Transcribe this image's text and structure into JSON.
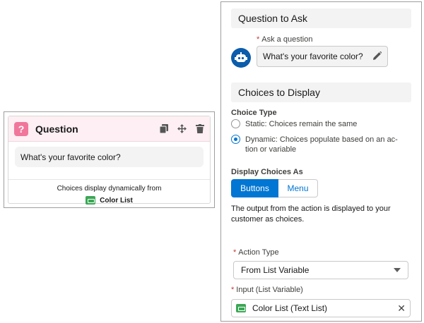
{
  "question_card": {
    "badge": "?",
    "title": "Question",
    "question_text": "What's your favorite color?",
    "footer_line1": "Choices display dynamically from",
    "footer_source": "Color List"
  },
  "panel": {
    "section1_title": "Question to Ask",
    "ask_label": "Ask a question",
    "ask_value": "What's your favorite color?",
    "section2_title": "Choices to Display",
    "choice_type_label": "Choice Type",
    "choice_static": "Static: Choices remain the same",
    "choice_dynamic": "Dynamic: Choices populate based on an ac-tion or variable",
    "display_as_label": "Display Choices As",
    "btn_buttons": "Buttons",
    "btn_menu": "Menu",
    "description": "The output from the action is displayed to your customer as choices.",
    "action_type_label": "Action Type",
    "action_type_value": "From List Variable",
    "input_label": "Input (List Variable)",
    "input_value": "Color List (Text List)",
    "required_mark": "*"
  },
  "colors": {
    "accent": "#0176d3",
    "question_badge": "#f1769c",
    "list_icon": "#3ba755"
  },
  "icons": [
    "copy-icon",
    "move-icon",
    "trash-icon",
    "pencil-icon",
    "bot-avatar-icon",
    "list-icon",
    "close-icon",
    "chevron-down-icon"
  ]
}
